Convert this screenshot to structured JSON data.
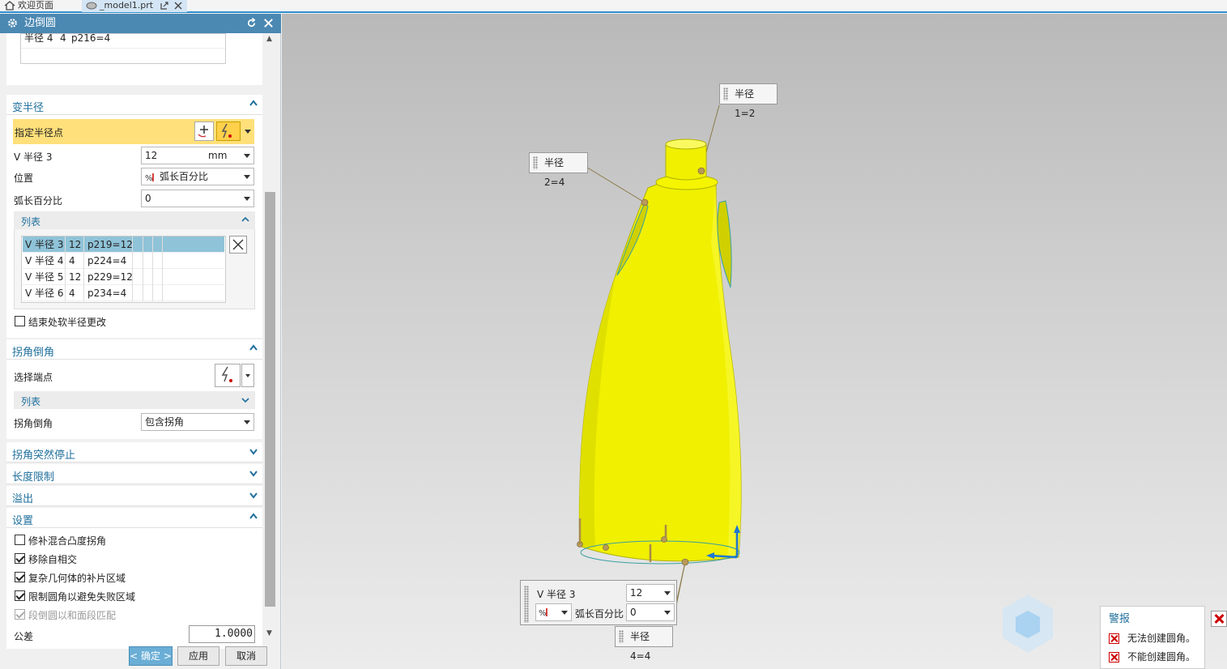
{
  "tabs": [
    {
      "label": "欢迎页面",
      "icon": "home-icon"
    },
    {
      "label": "_model1.prt",
      "icon": "part-icon"
    }
  ],
  "dialog": {
    "title": "边倒圆",
    "top_table_row": {
      "c1": "半径 4",
      "c2": "4",
      "c3": "p216=4"
    },
    "var_radius": {
      "title": "变半径",
      "specify_point": "指定半径点",
      "v_radius_label": "V 半径 3",
      "v_radius_value": "12",
      "v_radius_unit": "mm",
      "position_label": "位置",
      "position_value": "弧长百分比",
      "arc_percent_label": "弧长百分比",
      "arc_percent_value": "0",
      "list_title": "列表",
      "list_rows": [
        {
          "name": "V 半径 3",
          "val": "12",
          "expr": "p219=12"
        },
        {
          "name": "V 半径 4",
          "val": "4",
          "expr": "p224=4"
        },
        {
          "name": "V 半径 5",
          "val": "12",
          "expr": "p229=12"
        },
        {
          "name": "V 半径 6",
          "val": "4",
          "expr": "p234=4"
        }
      ],
      "soft_change": "结束处软半径更改"
    },
    "corner": {
      "title": "拐角倒角",
      "select_end": "选择端点",
      "list_title": "列表",
      "corner_label": "拐角倒角",
      "corner_value": "包含拐角"
    },
    "collapsed_sections": [
      "拐角突然停止",
      "长度限制",
      "溢出"
    ],
    "settings": {
      "title": "设置",
      "options": [
        {
          "label": "修补混合凸度拐角",
          "checked": false,
          "disabled": false
        },
        {
          "label": "移除自相交",
          "checked": true,
          "disabled": false
        },
        {
          "label": "复杂几何体的补片区域",
          "checked": true,
          "disabled": false
        },
        {
          "label": "限制圆角以避免失败区域",
          "checked": true,
          "disabled": false
        },
        {
          "label": "段倒圆以和面段匹配",
          "checked": true,
          "disabled": true
        }
      ],
      "tolerance_label": "公差",
      "tolerance_value": "1.0000"
    },
    "buttons": {
      "ok": "< 确定 >",
      "apply": "应用",
      "cancel": "取消"
    }
  },
  "viewport": {
    "callouts": [
      "半径 1=2",
      "半径 2=4",
      "半径 4=4"
    ],
    "edit": {
      "radius_label": "V 半径 3",
      "radius_value": "12",
      "position_label": "弧长百分比",
      "position_value": "0"
    },
    "alarm": {
      "title": "警报",
      "messages": [
        "无法创建圆角。",
        "不能创建圆角。"
      ]
    }
  },
  "colors": {
    "accent": "#4b88b2",
    "highlight": "#ffe07a",
    "part": "#f0f000",
    "section_title": "#1f6f9c"
  }
}
